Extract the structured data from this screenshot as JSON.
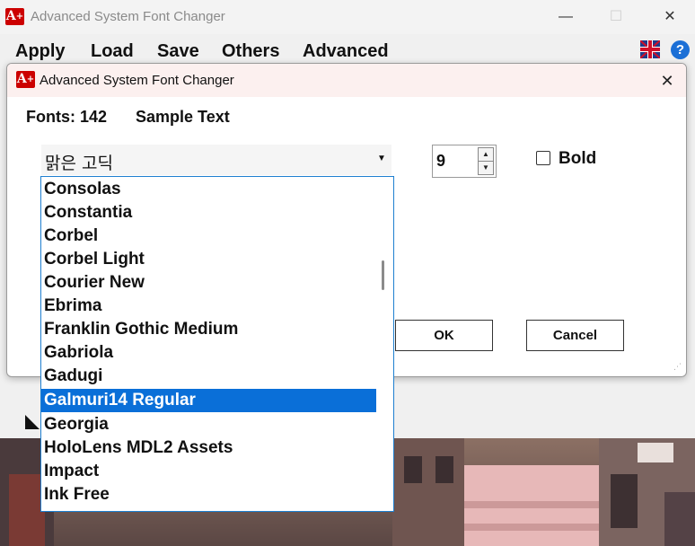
{
  "main_window": {
    "title": "Advanced System Font Changer",
    "logo_text": "A",
    "logo_plus": "+",
    "controls": {
      "minimize": "—",
      "maximize": "☐",
      "close": "✕"
    },
    "menu": [
      "Apply",
      "Load",
      "Save",
      "Others",
      "Advanced"
    ],
    "help": "?"
  },
  "dialog": {
    "title": "Advanced System Font Changer",
    "close": "✕",
    "fonts_count": "Fonts: 142",
    "sample_text": "Sample Text",
    "font_combo_value": "맑은 고딕",
    "combo_arrow": "▼",
    "size_value": "9",
    "spin_up": "▲",
    "spin_down": "▼",
    "bold_label": "Bold",
    "bold_checked": false,
    "ok_label": "OK",
    "cancel_label": "Cancel",
    "grip": "⋰"
  },
  "font_list": {
    "items": [
      "Consolas",
      "Constantia",
      "Corbel",
      "Corbel Light",
      "Courier New",
      "Ebrima",
      "Franklin Gothic Medium",
      "Gabriola",
      "Gadugi",
      "Galmuri14 Regular",
      "Georgia",
      "HoloLens MDL2 Assets",
      "Impact",
      "Ink Free"
    ],
    "selected": "Galmuri14 Regular"
  },
  "colors": {
    "accent": "#0a6fd8",
    "logo_red": "#cc0000",
    "dialog_title_bg": "#fcf0ef",
    "list_border": "#1e7fd0"
  }
}
